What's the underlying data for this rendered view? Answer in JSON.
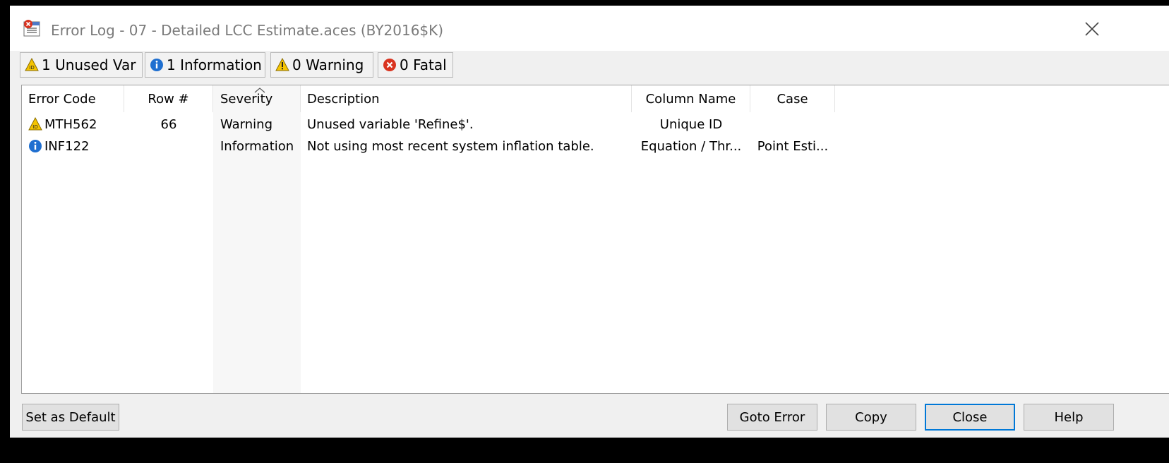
{
  "window": {
    "title": "Error Log - 07 - Detailed LCC Estimate.aces (BY2016$K)"
  },
  "tabs": [
    {
      "label": "1 Unused Var",
      "icon": "unused-variable-icon"
    },
    {
      "label": "1 Information",
      "icon": "info-icon"
    },
    {
      "label": "0 Warning",
      "icon": "warning-icon"
    },
    {
      "label": "0 Fatal",
      "icon": "fatal-icon"
    }
  ],
  "table": {
    "columns": [
      "Error Code",
      "Row #",
      "Severity",
      "Description",
      "Column Name",
      "Case"
    ],
    "sorted_column": "Severity",
    "rows": [
      {
        "icon": "unused-variable-icon",
        "code": "MTH562",
        "row": "66",
        "severity": "Warning",
        "description": "Unused variable 'Refine$'.",
        "column_name": "Unique ID",
        "case": ""
      },
      {
        "icon": "info-icon",
        "code": "INF122",
        "row": "",
        "severity": "Information",
        "description": "Not using most recent system inflation table.",
        "column_name": "Equation / Thr...",
        "case": "Point Esti..."
      }
    ]
  },
  "buttons": {
    "set_default": "Set as Default",
    "goto_error": "Goto Error",
    "copy": "Copy",
    "close": "Close",
    "help": "Help"
  },
  "colors": {
    "accent": "#0078d7",
    "info_blue": "#1f6fd0",
    "warning_yellow": "#f5c400",
    "fatal_red": "#d9331f"
  }
}
